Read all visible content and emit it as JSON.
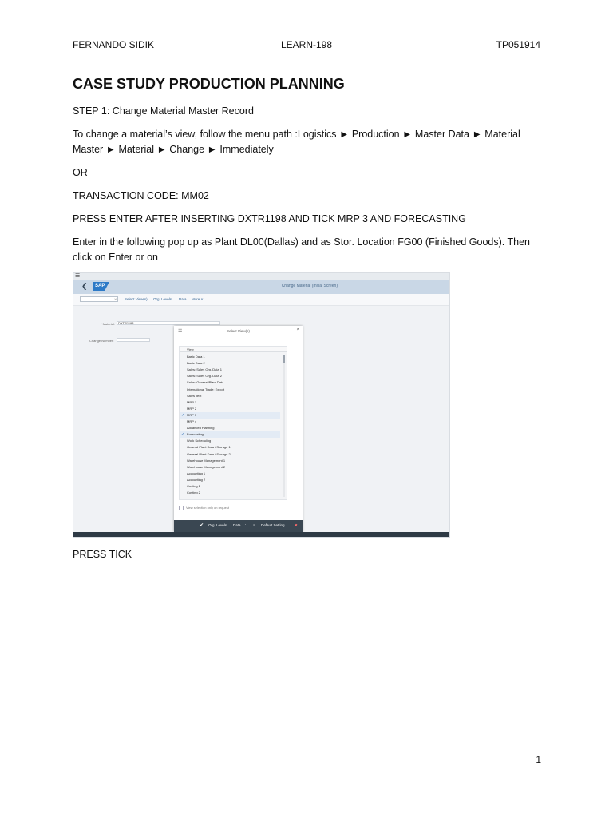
{
  "header": {
    "left": "FERNANDO SIDIK",
    "center": "LEARN-198",
    "right": "TP051914"
  },
  "title": "CASE STUDY PRODUCTION PLANNING",
  "step1": "STEP 1: Change Material Master Record",
  "menu_path": "To change a material’s view, follow the menu path :Logistics ► Production ► Master Data ► Material Master ► Material ► Change ► Immediately",
  "or": "OR",
  "transaction": "TRANSACTION CODE: MM02",
  "press_enter": "PRESS ENTER AFTER INSERTING DXTR1198 AND TICK MRP 3 AND FORECASTING",
  "popup_instruction": "Enter in the following pop up as Plant DL00(Dallas) and as Stor. Location FG00 (Finished Goods). Then click on Enter or on",
  "press_tick": "PRESS TICK",
  "page_number": "1",
  "screenshot": {
    "screen_title": "Change Material (Initial Screen)",
    "toolbar": {
      "select_views": "Select View(s)",
      "org_levels": "Org. Levels",
      "data": "Data",
      "more": "More ∨"
    },
    "material_label": "* Material:",
    "material_value": "DXTR1198",
    "change_number_label": "Change Number:",
    "dialog": {
      "title": "Select View(s)",
      "column_header": "View",
      "views": [
        {
          "label": "Basic Data 1",
          "checked": false
        },
        {
          "label": "Basic Data 2",
          "checked": false
        },
        {
          "label": "Sales: Sales Org. Data 1",
          "checked": false
        },
        {
          "label": "Sales: Sales Org. Data 2",
          "checked": false
        },
        {
          "label": "Sales: General/Plant Data",
          "checked": false
        },
        {
          "label": "International Trade: Export",
          "checked": false
        },
        {
          "label": "Sales Text",
          "checked": false
        },
        {
          "label": "MRP 1",
          "checked": false
        },
        {
          "label": "MRP 2",
          "checked": false
        },
        {
          "label": "MRP 3",
          "checked": true
        },
        {
          "label": "MRP 4",
          "checked": false
        },
        {
          "label": "Advanced Planning",
          "checked": false
        },
        {
          "label": "Forecasting",
          "checked": true
        },
        {
          "label": "Work Scheduling",
          "checked": false
        },
        {
          "label": "General Plant Data / Storage 1",
          "checked": false
        },
        {
          "label": "General Plant Data / Storage 2",
          "checked": false
        },
        {
          "label": "Warehouse Management 1",
          "checked": false
        },
        {
          "label": "Warehouse Management 2",
          "checked": false
        },
        {
          "label": "Accounting 1",
          "checked": false
        },
        {
          "label": "Accounting 2",
          "checked": false
        },
        {
          "label": "Costing 1",
          "checked": false
        },
        {
          "label": "Costing 2",
          "checked": false
        }
      ],
      "option_label": "View selection only on request",
      "footer": {
        "org_levels": "Org. Levels",
        "data": "Data",
        "default_setting": "Default Setting"
      }
    }
  }
}
